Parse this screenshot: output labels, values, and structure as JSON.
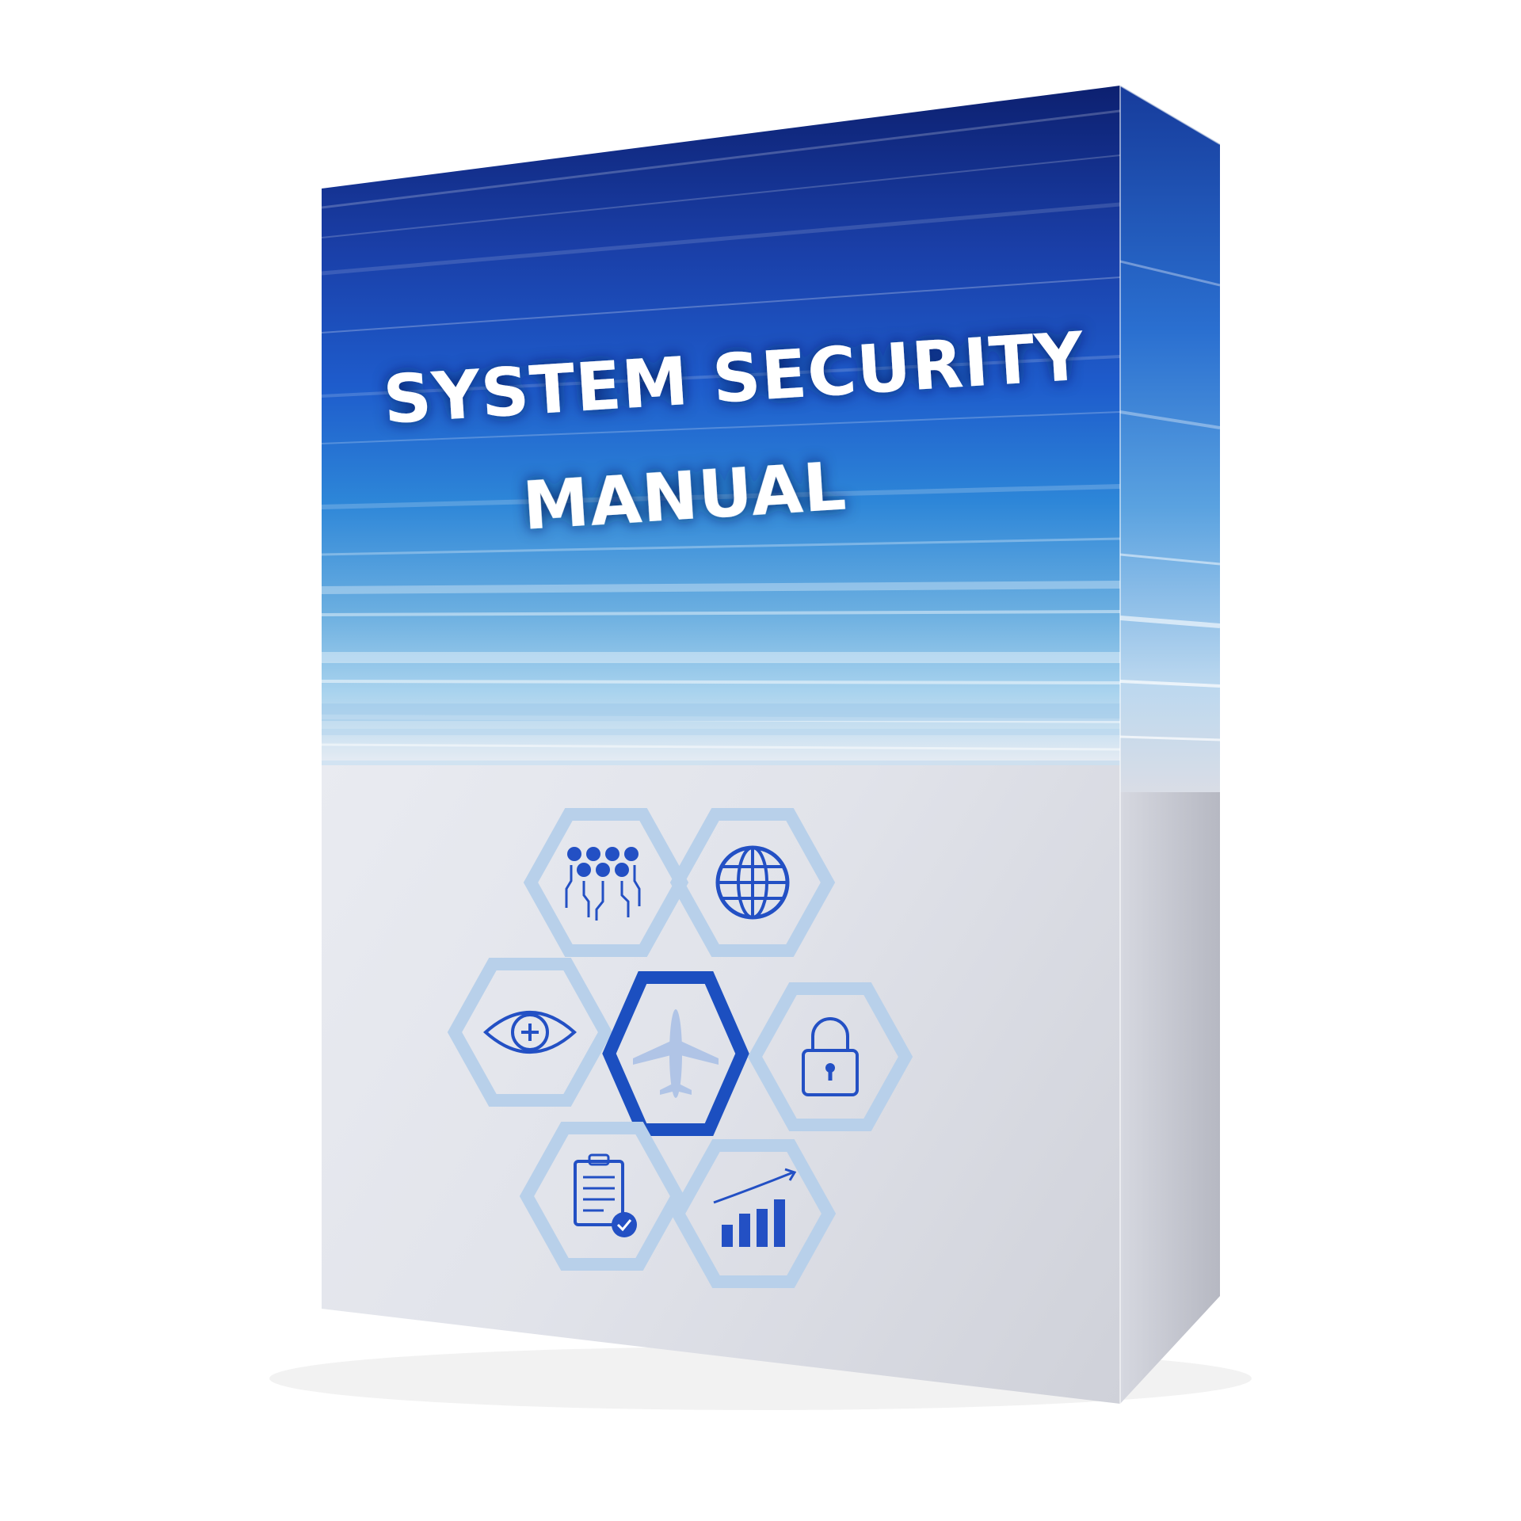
{
  "product": {
    "title_line1": "SYSTEM SECURITY",
    "title_line2": "MANUAL"
  },
  "colors": {
    "band_dark": "#0f2a8a",
    "band_mid": "#1c57c9",
    "band_light": "#6fb2e6",
    "cover_bg": "#e3e6ee",
    "hex_light": "#b8d0ea",
    "hex_dark": "#1c4fc0",
    "icon": "#2350c4"
  },
  "icons": [
    "people-network-icon",
    "globe-icon",
    "eye-plus-icon",
    "airplane-icon",
    "padlock-icon",
    "clipboard-check-icon",
    "growth-chart-icon"
  ]
}
